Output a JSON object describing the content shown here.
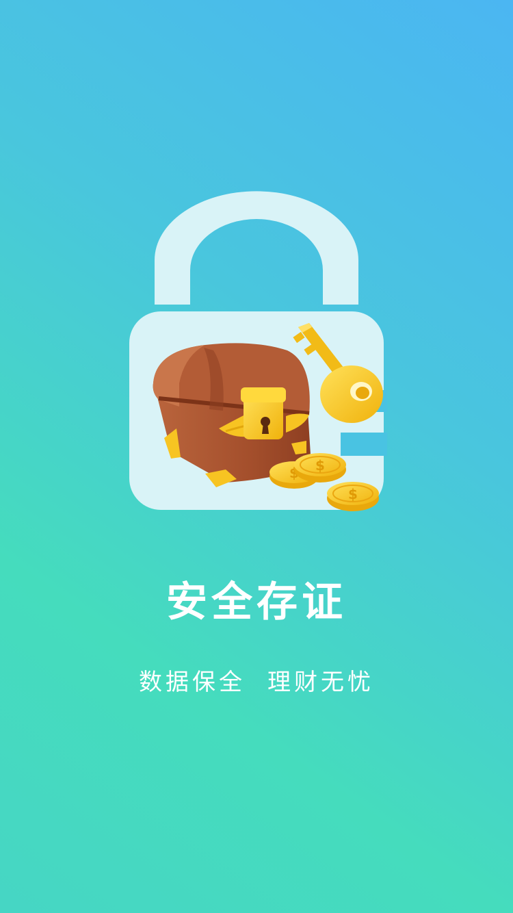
{
  "splash": {
    "title": "安全存证",
    "slogan_left": "数据保全",
    "slogan_right": "理财无忧"
  },
  "illustration": {
    "icon": "padlock-icon",
    "items": [
      "treasure-chest-icon",
      "key-icon",
      "gold-coin-icon"
    ],
    "colors": {
      "lock": "#d9f3f7",
      "chest": "#a14a2a",
      "gold": "#f7c422"
    }
  },
  "colors": {
    "background_top": "#4bb6f2",
    "background_bottom": "#45dcbd",
    "text": "#ffffff"
  }
}
